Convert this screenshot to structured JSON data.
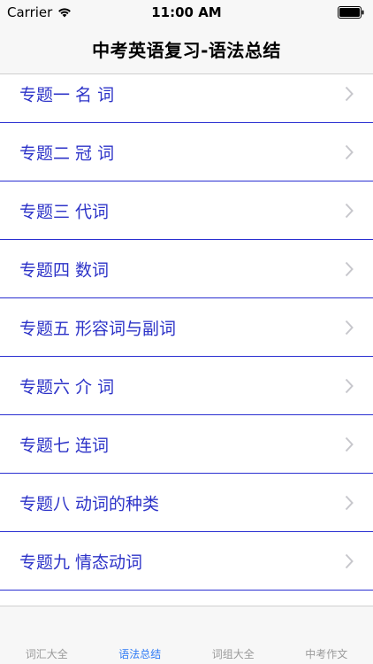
{
  "status_bar": {
    "carrier": "Carrier",
    "time": "11:00 AM"
  },
  "nav": {
    "title": "中考英语复习-语法总结"
  },
  "list": {
    "items": [
      {
        "label": "专题一 名 词"
      },
      {
        "label": "专题二 冠 词"
      },
      {
        "label": "专题三 代词"
      },
      {
        "label": "专题四 数词"
      },
      {
        "label": "专题五 形容词与副词"
      },
      {
        "label": "专题六 介 词"
      },
      {
        "label": "专题七 连词"
      },
      {
        "label": "专题八 动词的种类"
      },
      {
        "label": "专题九 情态动词"
      }
    ]
  },
  "tabs": [
    {
      "label": "词汇大全",
      "active": false
    },
    {
      "label": "语法总结",
      "active": true
    },
    {
      "label": "词组大全",
      "active": false
    },
    {
      "label": "中考作文",
      "active": false
    }
  ],
  "colors": {
    "item_text": "#2d33c8",
    "separator": "#2a2fd1",
    "tab_active": "#2f7bf6",
    "tab_inactive": "#9a9a9a"
  }
}
